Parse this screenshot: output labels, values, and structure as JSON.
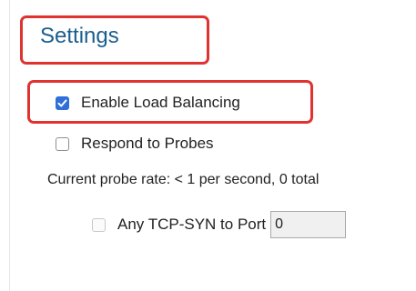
{
  "settings": {
    "title": "Settings",
    "enable_load_balancing": {
      "label": "Enable Load Balancing",
      "checked": true
    },
    "respond_to_probes": {
      "label": "Respond to Probes",
      "checked": false
    },
    "probe_rate_text": "Current probe rate: < 1 per second, 0 total",
    "any_tcp_syn": {
      "label": "Any TCP-SYN to Port",
      "checked": false,
      "disabled": true,
      "port_value": "0"
    }
  },
  "colors": {
    "title": "#1a5e8f",
    "highlight": "#e0322f",
    "checkbox_checked": "#2f6fd8"
  },
  "icons": [
    "checkmark-icon"
  ]
}
